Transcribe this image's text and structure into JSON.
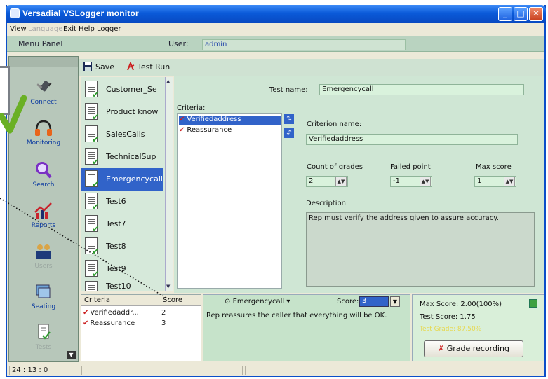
{
  "window": {
    "title": "Versadial VSLogger monitor",
    "min": "_",
    "max": "□",
    "close": "✕"
  },
  "menu": {
    "items": [
      "View",
      "Language",
      "Exit",
      "Help",
      "Logger"
    ]
  },
  "menu_panel": {
    "title": "Menu Panel",
    "user_label": "User:",
    "user_value": "admin"
  },
  "sidebar": {
    "items": [
      "Connect",
      "Monitoring",
      "Search",
      "Reports",
      "Users",
      "Seating",
      "Tests"
    ]
  },
  "toolbar": {
    "save": "Save",
    "testrun": "Test Run"
  },
  "tests": [
    "Customer_Se",
    "Product know",
    "SalesCalls",
    "TechnicalSup",
    "Emergencycall",
    "Test6",
    "Test7",
    "Test8",
    "Test9",
    "Test10"
  ],
  "selected_test_index": 4,
  "test_name": {
    "label": "Test name:",
    "value": "Emergencycall"
  },
  "criteria": {
    "label": "Criteria:",
    "items": [
      "Verifiedaddress",
      "Reassurance"
    ]
  },
  "criterion_name": {
    "label": "Criterion name:",
    "value": "Verifiedaddress"
  },
  "count_of_grades": {
    "label": "Count of grades",
    "value": "2"
  },
  "failed_point": {
    "label": "Failed point",
    "value": "-1"
  },
  "max_score": {
    "label": "Max score",
    "value": "1"
  },
  "description": {
    "label": "Description",
    "value": "Rep must verify the address given to assure accuracy."
  },
  "grades": {
    "headers": [
      "Criteria",
      "Score"
    ],
    "rows": [
      {
        "name": "Verifiedaddr...",
        "score": "2"
      },
      {
        "name": "Reassurance",
        "score": "3"
      }
    ]
  },
  "comment": {
    "test": "Emergencycall",
    "score_label": "Score:",
    "score_value": "3",
    "text": "Rep reassures the caller that everything will be OK."
  },
  "scores": {
    "max": "Max Score: 2.00(100%)",
    "test": "Test Score: 1.75",
    "result": "Test Grade: 87.50%"
  },
  "grade_button": "Grade recording",
  "status": {
    "time": "24 : 13 : 0"
  },
  "colors": {
    "accent": "#3163c9",
    "panel": "#cfe6d4",
    "title": "#0a5ad9",
    "check_red": "#cc2222",
    "check_green": "#3a9a2a"
  }
}
